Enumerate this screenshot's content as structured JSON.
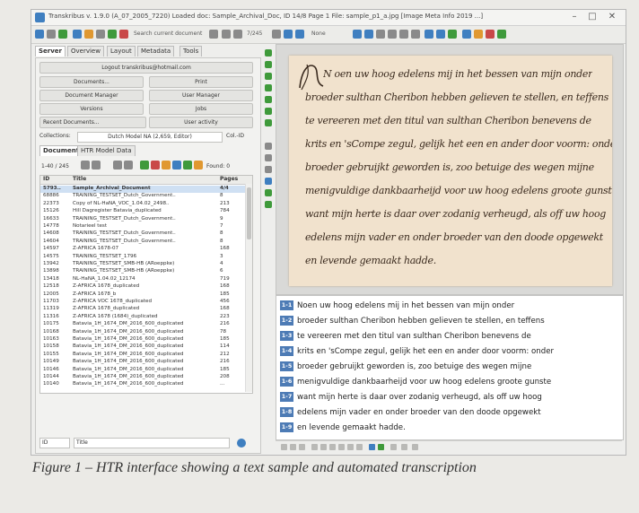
{
  "window": {
    "title": "Transkribus v. 1.9.0 (A_07_2005_7220) Loaded doc: Sample_Archival_Doc, ID 14/8 Page 1 File: sample_p1_a.jpg [Image Meta Info 2019 ...]",
    "minimize": "–",
    "maximize": "□",
    "close": "✕"
  },
  "toolbar": {
    "search_text": "Search current document",
    "page_counter": "7/245",
    "zoom_option": "None",
    "colors": {
      "green": "#3f9a3b",
      "blue": "#3f7fc0",
      "orange": "#e09830",
      "red": "#c94848",
      "gray": "#8a8a8a"
    }
  },
  "tabs": [
    "Server",
    "Overview",
    "Layout",
    "Metadata",
    "Tools"
  ],
  "server_panel": {
    "login_button": "Logout transkribus@hotmail.com",
    "buttons": [
      {
        "label": "Documents...",
        "icon": "folder-icon"
      },
      {
        "label": "Print",
        "icon": "print-icon"
      },
      {
        "label": "Document Manager",
        "icon": "folder-icon"
      },
      {
        "label": "User Manager",
        "icon": "users-icon"
      },
      {
        "label": "Versions",
        "icon": "versions-icon"
      },
      {
        "label": "Jobs",
        "icon": "jobs-icon"
      },
      {
        "label": "Recent Documents...",
        "icon": "dropdown-icon"
      },
      {
        "label": "User activity",
        "icon": "activity-icon"
      }
    ],
    "collections_label": "Collections:",
    "collections_value": "Dutch Model NA (2,659, Editor)",
    "collections_id": "Col.-ID",
    "documents_tab": "Documents",
    "htr_tab": "HTR Model Data",
    "pager_text": "1-40 / 245",
    "found_text": "Found: 0",
    "columns": [
      "ID",
      "Title",
      "Pages"
    ],
    "documents": [
      {
        "id": "5793..",
        "title": "Sample_Archival_Document",
        "pages": "4/4",
        "selected": true
      },
      {
        "id": "68886",
        "title": "TRAINING_TESTSET_Dutch_Government..",
        "pages": "8"
      },
      {
        "id": "22373",
        "title": "Copy of NL-HaNA_VOC_1.04.02_2498..",
        "pages": "213"
      },
      {
        "id": "15126",
        "title": "Hill Dagregister Batavia_duplicated",
        "pages": "784"
      },
      {
        "id": "16633",
        "title": "TRAINING_TESTSET_Dutch_Government..",
        "pages": "9"
      },
      {
        "id": "14778",
        "title": "Notarieel test",
        "pages": "7"
      },
      {
        "id": "14608",
        "title": "TRAINING_TESTSET_Dutch_Government..",
        "pages": "8"
      },
      {
        "id": "14604",
        "title": "TRAINING_TESTSET_Dutch_Government..",
        "pages": "8"
      },
      {
        "id": "14597",
        "title": "Z-AFRICA 1678-07",
        "pages": "168"
      },
      {
        "id": "14575",
        "title": "TRAINING_TESTSET_1796",
        "pages": "3"
      },
      {
        "id": "13942",
        "title": "TRAINING_TESTSET_SMB-HB (ARoeppke)",
        "pages": "4"
      },
      {
        "id": "13898",
        "title": "TRAINING_TESTSET_SMB-HB (ARoeppke)",
        "pages": "6"
      },
      {
        "id": "13418",
        "title": "NL-HaNA_1.04.02_12174",
        "pages": "719"
      },
      {
        "id": "12518",
        "title": "Z-AFRICA 1678_duplicated",
        "pages": "168"
      },
      {
        "id": "12005",
        "title": "Z-AFRICA 1678_b",
        "pages": "185"
      },
      {
        "id": "11703",
        "title": "Z-AFRICA VOC 1678_duplicated",
        "pages": "456"
      },
      {
        "id": "11319",
        "title": "Z-AFRICA 1678_duplicated",
        "pages": "168"
      },
      {
        "id": "11316",
        "title": "Z-AFRICA 1678 (1684)_duplicated",
        "pages": "223"
      },
      {
        "id": "10175",
        "title": "Batavia_1H_1674_DM_2016_600_duplicated",
        "pages": "216"
      },
      {
        "id": "10168",
        "title": "Batavia_1H_1674_DM_2016_600_duplicated",
        "pages": "78"
      },
      {
        "id": "10163",
        "title": "Batavia_1H_1674_DM_2016_600_duplicated",
        "pages": "185"
      },
      {
        "id": "10158",
        "title": "Batavia_1H_1674_DM_2016_600_duplicated",
        "pages": "114"
      },
      {
        "id": "10155",
        "title": "Batavia_1H_1674_DM_2016_600_duplicated",
        "pages": "212"
      },
      {
        "id": "10149",
        "title": "Batavia_1H_1674_DM_2016_600_duplicated",
        "pages": "216"
      },
      {
        "id": "10146",
        "title": "Batavia_1H_1674_DM_2016_600_duplicated",
        "pages": "185"
      },
      {
        "id": "10144",
        "title": "Batavia_1H_1674_DM_2016_600_duplicated",
        "pages": "208"
      },
      {
        "id": "10140",
        "title": "Batavia_1H_1674_DM_2016_600_duplicated",
        "pages": "..."
      }
    ],
    "filter_select": "ID",
    "filter_value": "Title"
  },
  "handwriting": [
    "N  oen uw hoog edelens mij in het bessen van mijn onder",
    "broeder sulthan Cheribon hebben gelieven te stellen, en teffens",
    "te vereeren met den titul van sulthan Cheribon benevens de",
    "krits en 'sCompe zegul, gelijk het een en ander door voorm: onder",
    "broeder gebruijkt geworden is, zoo betuige des wegen mijne",
    "menigvuldige dankbaarheijd voor uw hoog edelens groote gunste",
    "want mijn herte is daar over zodanig verheugd, als off uw hoog",
    "edelens mijn vader en onder broeder van den doode opgewekt",
    "en levende gemaakt hadde."
  ],
  "transcription": [
    {
      "no": "1-1",
      "text": "Noen uw hoog edelens mij in het bessen van mijn onder"
    },
    {
      "no": "1-2",
      "text": "broeder sulthan Cheribon hebben gelieven te stellen, en teffens"
    },
    {
      "no": "1-3",
      "text": "te vereeren met den titul van sulthan Cheribon benevens de"
    },
    {
      "no": "1-4",
      "text": "krits en 'sCompe zegul, gelijk het een en ander door voorm: onder"
    },
    {
      "no": "1-5",
      "text": "broeder gebruijkt geworden is, zoo betuige des wegen mijne"
    },
    {
      "no": "1-6",
      "text": "menigvuldige dankbaarheijd voor uw hoog edelens groote gunste"
    },
    {
      "no": "1-7",
      "text": "want mijn herte is daar over zodanig verheugd, als off uw hoog"
    },
    {
      "no": "1-8",
      "text": "edelens mijn vader en onder broeder van den doode opgewekt"
    },
    {
      "no": "1-9",
      "text": "en levende gemaakt hadde."
    }
  ],
  "caption": "Figure 1 – HTR interface showing a text sample and automated transcription"
}
